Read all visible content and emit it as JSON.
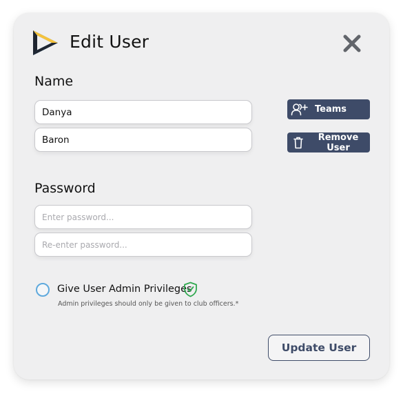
{
  "dialog": {
    "title": "Edit User",
    "logo_icon": "play-triangle-logo",
    "close_icon": "close-x-icon"
  },
  "name_section": {
    "label": "Name",
    "first_name_value": "Danya",
    "last_name_value": "Baron"
  },
  "password_section": {
    "label": "Password",
    "password_placeholder": "Enter password...",
    "confirm_placeholder": "Re-enter password..."
  },
  "actions": {
    "teams_label": "Teams",
    "teams_icon": "user-plus-icon",
    "remove_label": "Remove User",
    "remove_icon": "trash-icon",
    "update_label": "Update User"
  },
  "admin": {
    "label": "Give User Admin Privileges",
    "hint": "Admin privileges should only be given to club officers.*",
    "checked": false,
    "badge_icon": "shield-check-icon"
  },
  "colors": {
    "button_navy": "#3e4b68",
    "radio_blue": "#5ea9dd",
    "shield_green": "#2fa84f",
    "logo_yellow": "#f5c23c",
    "logo_blue": "#4a9fe0",
    "card_bg": "#efeff0"
  }
}
